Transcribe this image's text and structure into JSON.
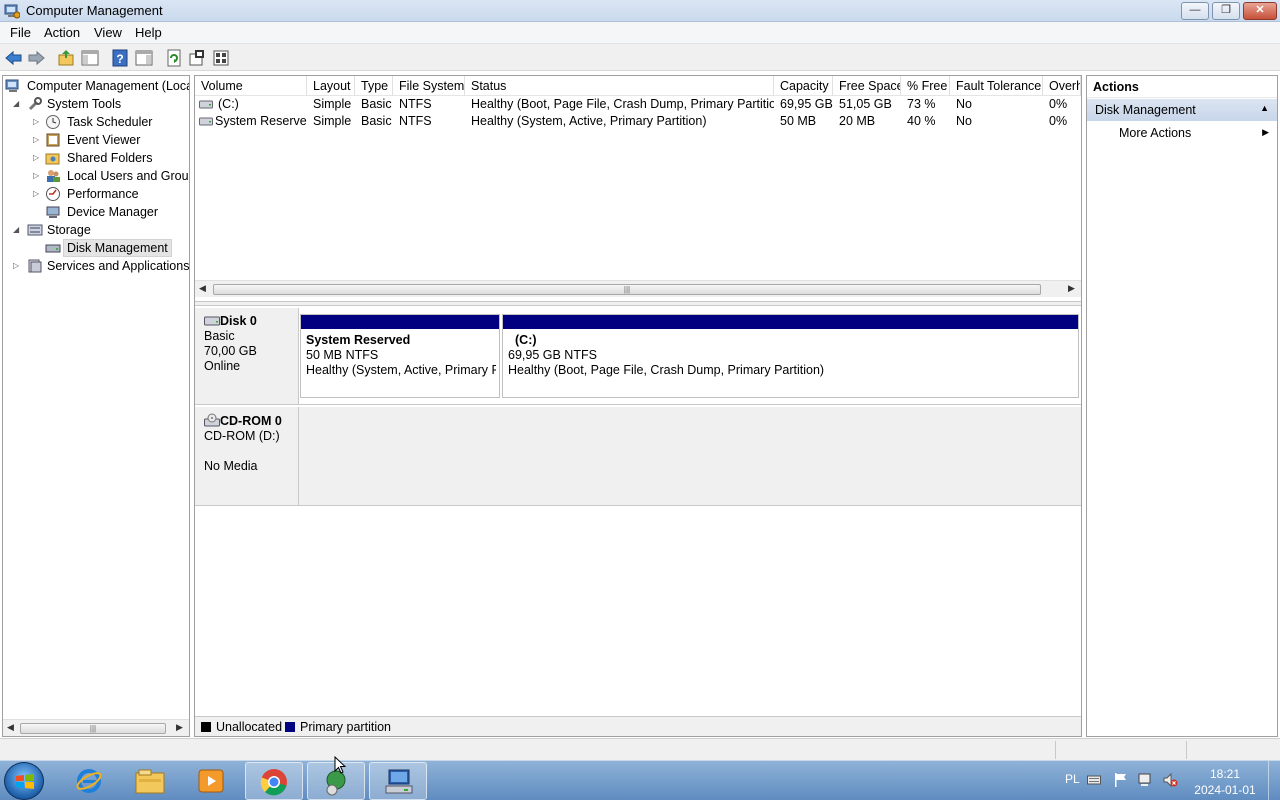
{
  "window": {
    "title": "Computer Management",
    "buttons": {
      "minimize": "—",
      "restore": "❐",
      "close": "✕"
    }
  },
  "menu": [
    "File",
    "Action",
    "View",
    "Help"
  ],
  "toolbar": {
    "icons": [
      "back-arrow-icon",
      "forward-arrow-icon",
      "up-folder-icon",
      "show-hide-console-tree-icon",
      "help-icon",
      "show-hide-action-pane-icon",
      "refresh-icon",
      "properties-icon",
      "export-icon"
    ]
  },
  "tree": {
    "root": "Computer Management (Local",
    "items": [
      {
        "label": "System Tools",
        "expanded": true
      },
      {
        "label": "Task Scheduler"
      },
      {
        "label": "Event Viewer"
      },
      {
        "label": "Shared Folders"
      },
      {
        "label": "Local Users and Groups"
      },
      {
        "label": "Performance"
      },
      {
        "label": "Device Manager"
      },
      {
        "label": "Storage",
        "expanded": true
      },
      {
        "label": "Disk Management",
        "selected": true
      },
      {
        "label": "Services and Applications"
      }
    ]
  },
  "volumes": {
    "columns": [
      "Volume",
      "Layout",
      "Type",
      "File System",
      "Status",
      "Capacity",
      "Free Space",
      "% Free",
      "Fault Tolerance",
      "Overh"
    ],
    "rows": [
      [
        "(C:)",
        "Simple",
        "Basic",
        "NTFS",
        "Healthy (Boot, Page File, Crash Dump, Primary Partition)",
        "69,95 GB",
        "51,05 GB",
        "73 %",
        "No",
        "0%"
      ],
      [
        "System Reserved",
        "Simple",
        "Basic",
        "NTFS",
        "Healthy (System, Active, Primary Partition)",
        "50 MB",
        "20 MB",
        "40 %",
        "No",
        "0%"
      ]
    ]
  },
  "disks": {
    "disk0": {
      "name": "Disk 0",
      "type": "Basic",
      "size": "70,00 GB",
      "state": "Online",
      "partitions": [
        {
          "name": "System Reserved",
          "size": "50 MB NTFS",
          "status": "Healthy (System, Active, Primary Pa"
        },
        {
          "name": "(C:)",
          "size": "69,95 GB NTFS",
          "status": "Healthy (Boot, Page File, Crash Dump, Primary Partition)"
        }
      ]
    },
    "cdrom0": {
      "name": "CD-ROM 0",
      "type": "CD-ROM (D:)",
      "media": "No Media"
    }
  },
  "legend": {
    "items": [
      {
        "label": "Unallocated",
        "color": "#000000"
      },
      {
        "label": "Primary partition",
        "color": "#000080"
      }
    ]
  },
  "actions": {
    "header": "Actions",
    "section": "Disk Management",
    "item": "More Actions"
  },
  "taskbar": {
    "apps": [
      "internet-explorer-icon",
      "file-explorer-icon",
      "media-player-icon",
      "chrome-icon",
      "remote-tool-icon",
      "computer-management-icon"
    ],
    "language": "PL",
    "time": "18:21",
    "date": "2024-01-01"
  },
  "colors": {
    "partition_bar": "#000080",
    "accent": "#dbe4f1"
  }
}
